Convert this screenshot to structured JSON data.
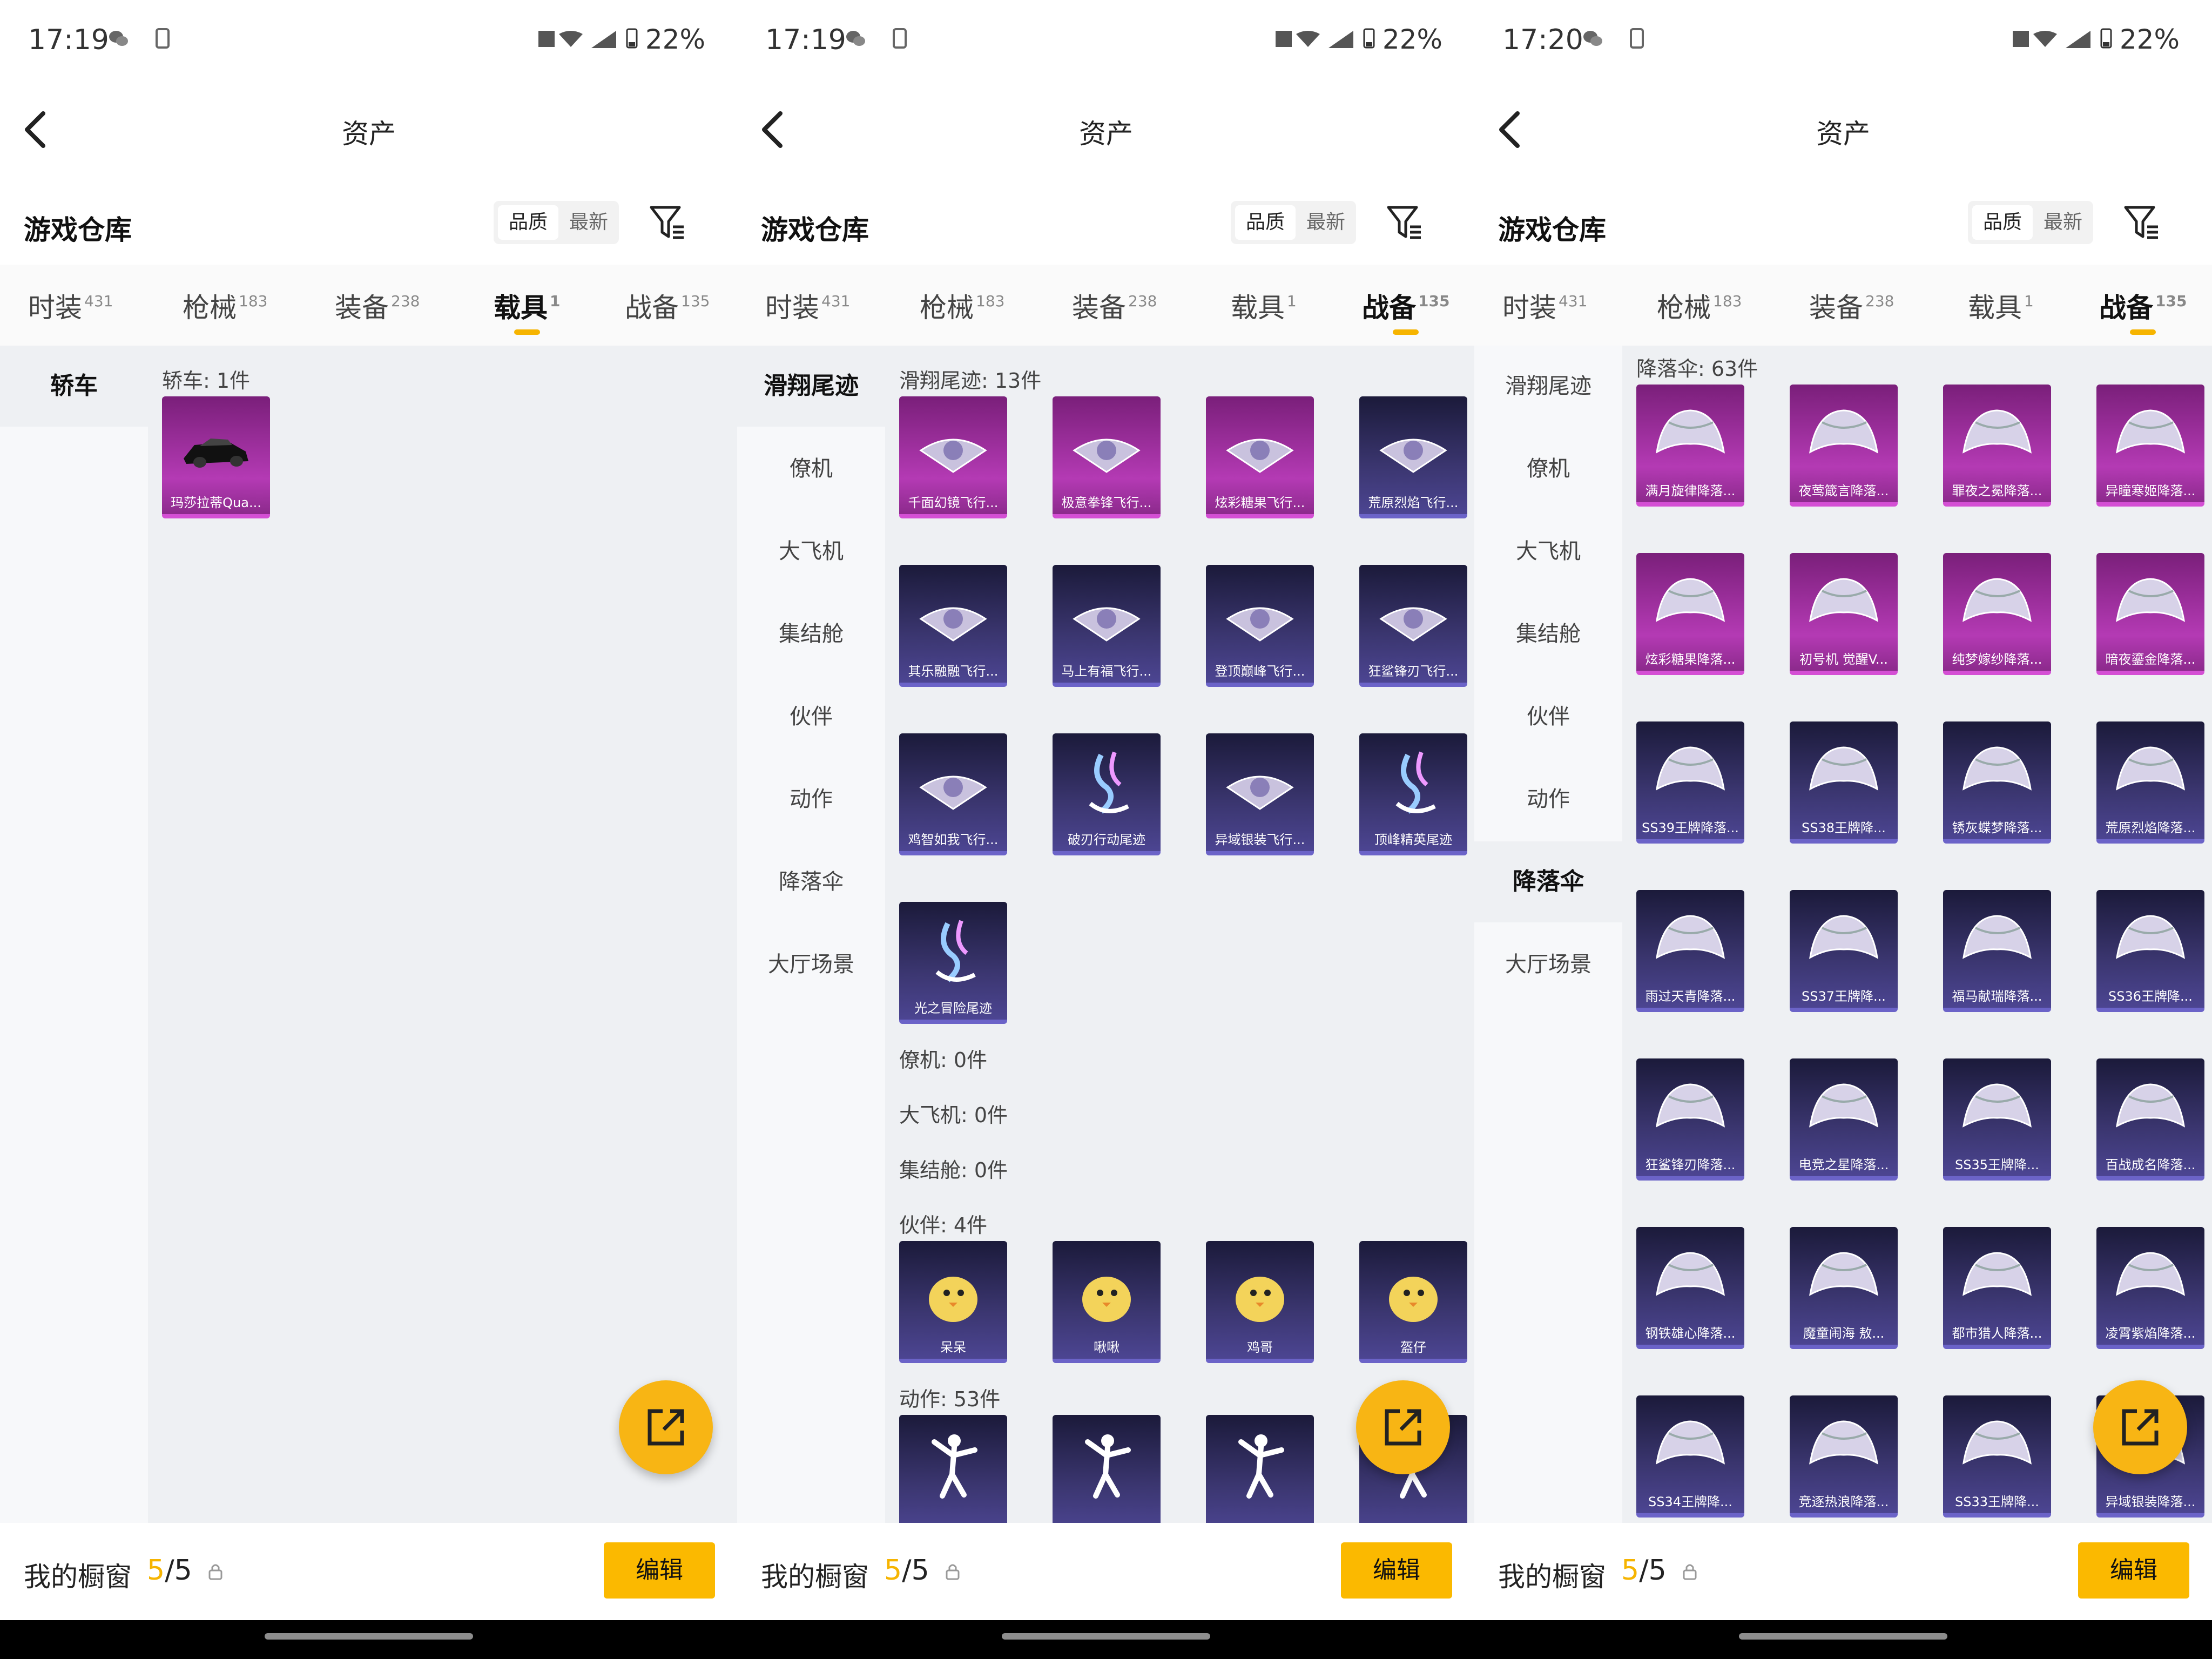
{
  "screens": [
    {
      "time": "17:19",
      "battery": "22%",
      "title": "资产",
      "warehouse_title": "游戏仓库",
      "sort": [
        "品质",
        "最新"
      ],
      "tabs": [
        {
          "label": "时装",
          "count": "431",
          "active": false
        },
        {
          "label": "枪械",
          "count": "183",
          "active": false
        },
        {
          "label": "装备",
          "count": "238",
          "active": false
        },
        {
          "label": "载具",
          "count": "1",
          "active": true
        },
        {
          "label": "战备",
          "count": "135",
          "active": false
        }
      ],
      "sidebar": [
        {
          "label": "轿车",
          "active": true
        }
      ],
      "sections": [
        {
          "label": "轿车: 1件",
          "items": [
            {
              "name": "玛莎拉蒂Qua...",
              "quality": "purple",
              "icon": "car-icon"
            }
          ]
        }
      ],
      "footer": {
        "label": "我的橱窗",
        "used": "5",
        "total": "/5",
        "edit": "编辑"
      }
    },
    {
      "time": "17:19",
      "battery": "22%",
      "title": "资产",
      "warehouse_title": "游戏仓库",
      "sort": [
        "品质",
        "最新"
      ],
      "tabs": [
        {
          "label": "时装",
          "count": "431",
          "active": false
        },
        {
          "label": "枪械",
          "count": "183",
          "active": false
        },
        {
          "label": "装备",
          "count": "238",
          "active": false
        },
        {
          "label": "载具",
          "count": "1",
          "active": false
        },
        {
          "label": "战备",
          "count": "135",
          "active": true
        }
      ],
      "sidebar": [
        {
          "label": "滑翔尾迹",
          "active": true
        },
        {
          "label": "僚机",
          "active": false
        },
        {
          "label": "大飞机",
          "active": false
        },
        {
          "label": "集结舱",
          "active": false
        },
        {
          "label": "伙伴",
          "active": false
        },
        {
          "label": "动作",
          "active": false
        },
        {
          "label": "降落伞",
          "active": false
        },
        {
          "label": "大厅场景",
          "active": false
        }
      ],
      "sections": [
        {
          "label": "滑翔尾迹: 13件",
          "items": [
            {
              "name": "千面幻镜飞行...",
              "quality": "purple",
              "icon": "glider-icon"
            },
            {
              "name": "极意拳锋飞行...",
              "quality": "purple",
              "icon": "glider-icon"
            },
            {
              "name": "炫彩糖果飞行...",
              "quality": "purple",
              "icon": "glider-icon"
            },
            {
              "name": "荒原烈焰飞行...",
              "quality": "blue",
              "icon": "glider-icon"
            },
            {
              "name": "其乐融融飞行...",
              "quality": "blue",
              "icon": "glider-icon"
            },
            {
              "name": "马上有福飞行...",
              "quality": "blue",
              "icon": "glider-icon"
            },
            {
              "name": "登顶巅峰飞行...",
              "quality": "blue",
              "icon": "glider-icon"
            },
            {
              "name": "狂鲨锋刃飞行...",
              "quality": "blue",
              "icon": "glider-icon"
            },
            {
              "name": "鸡智如我飞行...",
              "quality": "blue",
              "icon": "glider-icon"
            },
            {
              "name": "破刃行动尾迹",
              "quality": "blue",
              "icon": "trail-icon"
            },
            {
              "name": "异域银装飞行...",
              "quality": "blue",
              "icon": "glider-icon"
            },
            {
              "name": "顶峰精英尾迹",
              "quality": "blue",
              "icon": "trail-icon"
            },
            {
              "name": "光之冒险尾迹",
              "quality": "blue",
              "icon": "trail-icon"
            }
          ]
        },
        {
          "label": "僚机: 0件",
          "items": []
        },
        {
          "label": "大飞机: 0件",
          "items": []
        },
        {
          "label": "集结舱: 0件",
          "items": []
        },
        {
          "label": "伙伴: 4件",
          "items": [
            {
              "name": "呆呆",
              "quality": "blue",
              "icon": "companion-icon"
            },
            {
              "name": "啾啾",
              "quality": "blue",
              "icon": "companion-icon"
            },
            {
              "name": "鸡哥",
              "quality": "blue",
              "icon": "companion-icon"
            },
            {
              "name": "盔仔",
              "quality": "blue",
              "icon": "companion-icon"
            }
          ]
        },
        {
          "label": "动作: 53件",
          "items": [
            {
              "name": "",
              "quality": "blue",
              "icon": "dance-icon"
            },
            {
              "name": "",
              "quality": "blue",
              "icon": "dance-icon"
            },
            {
              "name": "",
              "quality": "blue",
              "icon": "dance-icon"
            },
            {
              "name": "",
              "quality": "blue",
              "icon": "dance-icon"
            }
          ]
        }
      ],
      "footer": {
        "label": "我的橱窗",
        "used": "5",
        "total": "/5",
        "edit": "编辑"
      }
    },
    {
      "time": "17:20",
      "battery": "22%",
      "title": "资产",
      "warehouse_title": "游戏仓库",
      "sort": [
        "品质",
        "最新"
      ],
      "tabs": [
        {
          "label": "时装",
          "count": "431",
          "active": false
        },
        {
          "label": "枪械",
          "count": "183",
          "active": false
        },
        {
          "label": "装备",
          "count": "238",
          "active": false
        },
        {
          "label": "载具",
          "count": "1",
          "active": false
        },
        {
          "label": "战备",
          "count": "135",
          "active": true
        }
      ],
      "sidebar": [
        {
          "label": "滑翔尾迹",
          "active": false
        },
        {
          "label": "僚机",
          "active": false
        },
        {
          "label": "大飞机",
          "active": false
        },
        {
          "label": "集结舱",
          "active": false
        },
        {
          "label": "伙伴",
          "active": false
        },
        {
          "label": "动作",
          "active": false
        },
        {
          "label": "降落伞",
          "active": true
        },
        {
          "label": "大厅场景",
          "active": false
        }
      ],
      "sections": [
        {
          "label": "降落伞: 63件",
          "items": [
            {
              "name": "满月旋律降落...",
              "quality": "purple",
              "icon": "parachute-icon"
            },
            {
              "name": "夜莺箴言降落...",
              "quality": "purple",
              "icon": "parachute-icon"
            },
            {
              "name": "罪夜之冕降落...",
              "quality": "purple",
              "icon": "parachute-icon"
            },
            {
              "name": "异瞳寒姬降落...",
              "quality": "purple",
              "icon": "parachute-icon"
            },
            {
              "name": "炫彩糖果降落...",
              "quality": "purple",
              "icon": "parachute-icon"
            },
            {
              "name": "初号机 觉醒V...",
              "quality": "purple",
              "icon": "parachute-icon"
            },
            {
              "name": "纯梦嫁纱降落...",
              "quality": "purple",
              "icon": "parachute-icon"
            },
            {
              "name": "暗夜鎏金降落...",
              "quality": "purple",
              "icon": "parachute-icon"
            },
            {
              "name": "SS39王牌降落...",
              "quality": "blue",
              "icon": "parachute-icon"
            },
            {
              "name": "SS38王牌降...",
              "quality": "blue",
              "icon": "parachute-icon"
            },
            {
              "name": "锈灰蝶梦降落...",
              "quality": "blue",
              "icon": "parachute-icon"
            },
            {
              "name": "荒原烈焰降落...",
              "quality": "blue",
              "icon": "parachute-icon"
            },
            {
              "name": "雨过天青降落...",
              "quality": "blue",
              "icon": "parachute-icon"
            },
            {
              "name": "SS37王牌降...",
              "quality": "blue",
              "icon": "parachute-icon"
            },
            {
              "name": "福马献瑞降落...",
              "quality": "blue",
              "icon": "parachute-icon"
            },
            {
              "name": "SS36王牌降...",
              "quality": "blue",
              "icon": "parachute-icon"
            },
            {
              "name": "狂鲨锋刃降落...",
              "quality": "blue",
              "icon": "parachute-icon"
            },
            {
              "name": "电竞之星降落...",
              "quality": "blue",
              "icon": "parachute-icon"
            },
            {
              "name": "SS35王牌降...",
              "quality": "blue",
              "icon": "parachute-icon"
            },
            {
              "name": "百战成名降落...",
              "quality": "blue",
              "icon": "parachute-icon"
            },
            {
              "name": "钢铁雄心降落...",
              "quality": "blue",
              "icon": "parachute-icon"
            },
            {
              "name": "魔童闹海 敖...",
              "quality": "blue",
              "icon": "parachute-icon"
            },
            {
              "name": "都市猎人降落...",
              "quality": "blue",
              "icon": "parachute-icon"
            },
            {
              "name": "凌霄紫焰降落...",
              "quality": "blue",
              "icon": "parachute-icon"
            },
            {
              "name": "SS34王牌降...",
              "quality": "blue",
              "icon": "parachute-icon"
            },
            {
              "name": "竞逐热浪降落...",
              "quality": "blue",
              "icon": "parachute-icon"
            },
            {
              "name": "SS33王牌降...",
              "quality": "blue",
              "icon": "parachute-icon"
            },
            {
              "name": "异域银装降落...",
              "quality": "blue",
              "icon": "parachute-icon"
            }
          ]
        }
      ],
      "footer": {
        "label": "我的橱窗",
        "used": "5",
        "total": "/5",
        "edit": "编辑"
      }
    }
  ]
}
